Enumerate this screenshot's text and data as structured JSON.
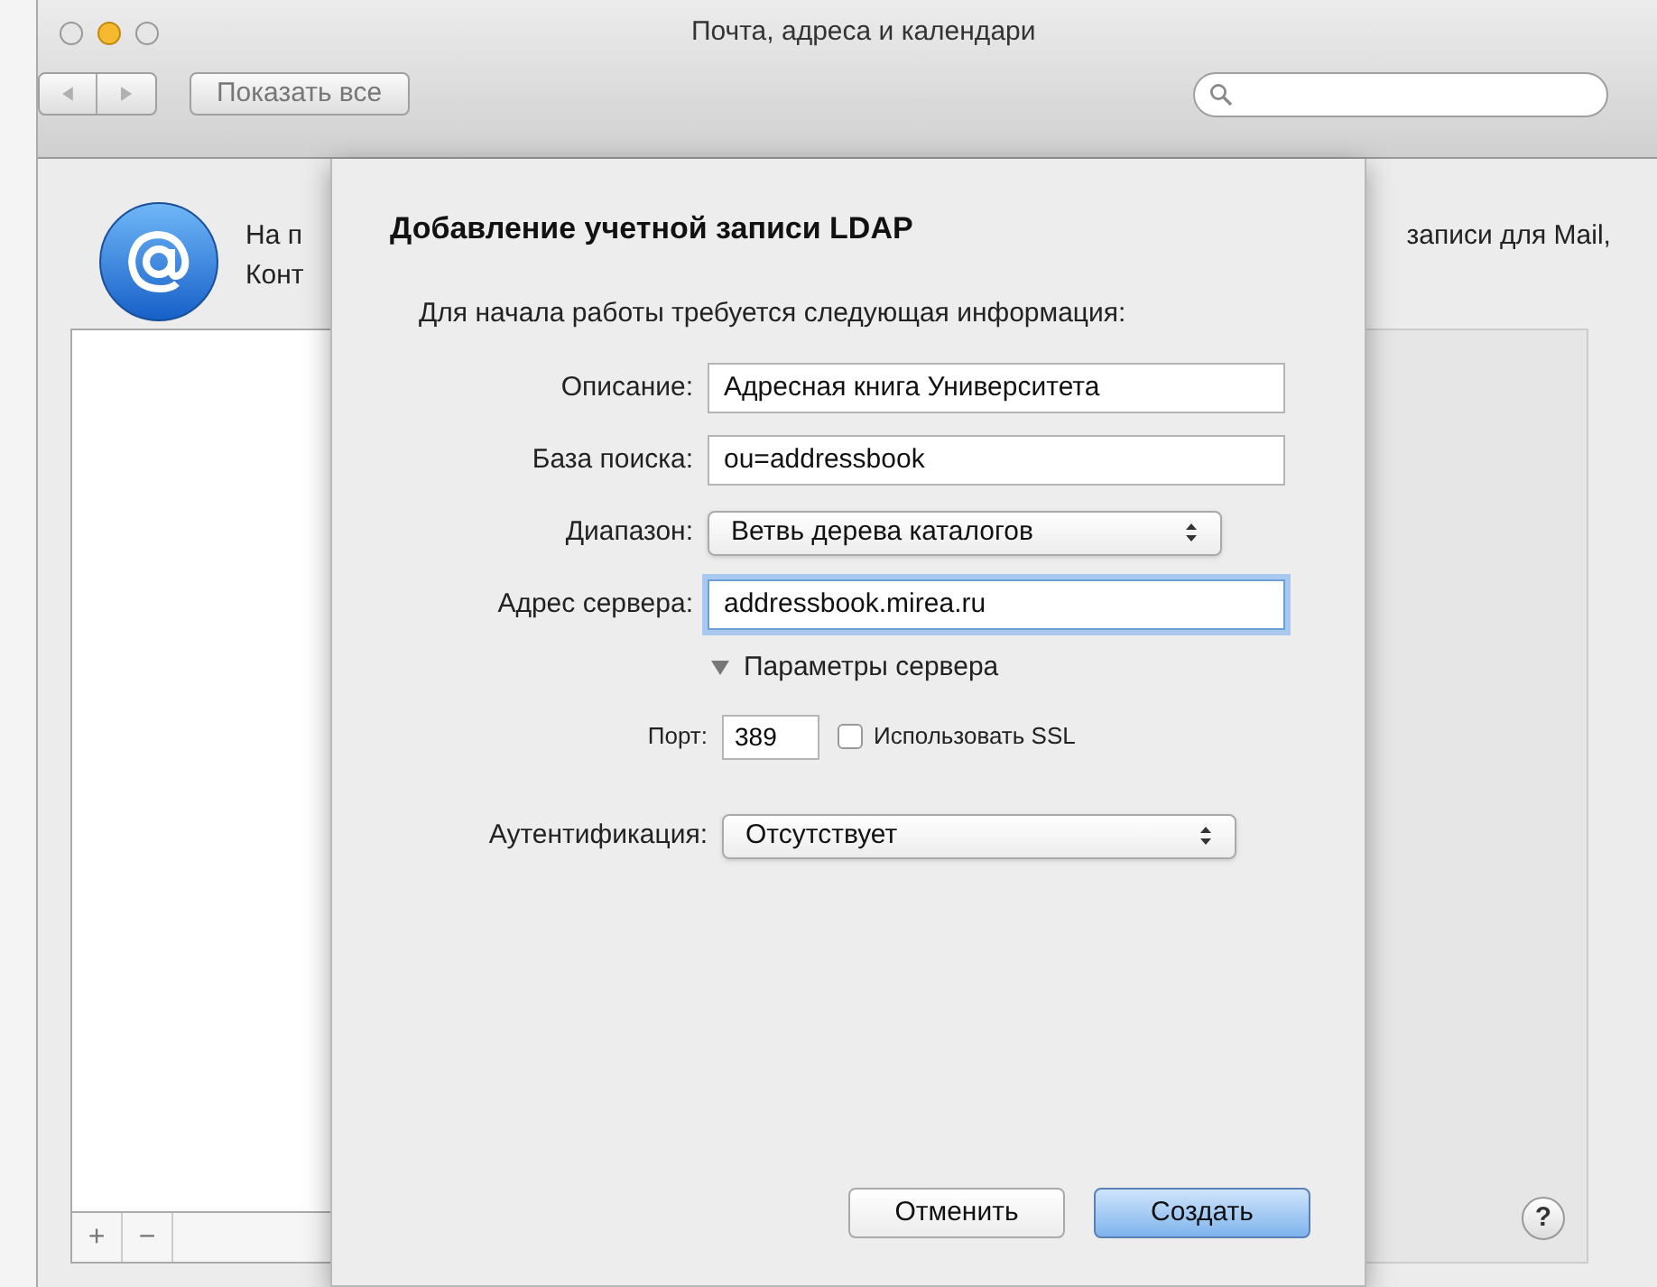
{
  "window": {
    "title": "Почта, адреса и календари"
  },
  "toolbar": {
    "show_all_button": "Показать все"
  },
  "intro": {
    "text_left_line_1": "На п",
    "text_left_line_2": "Конт",
    "text_right": "записи для Mail,"
  },
  "accounts_list": {
    "add_button": "+",
    "remove_button": "−"
  },
  "sheet": {
    "title": "Добавление учетной записи LDAP",
    "instruction": "Для начала работы требуется следующая информация:",
    "fields": [
      {
        "kind": "text",
        "label": "Описание:",
        "value": "Адресная книга Университета",
        "focused": false
      },
      {
        "kind": "text",
        "label": "База поиска:",
        "value": "ou=addressbook",
        "focused": false
      },
      {
        "kind": "select",
        "label": "Диапазон:",
        "value": "Ветвь дерева каталогов"
      },
      {
        "kind": "text",
        "label": "Адрес сервера:",
        "value": "addressbook.mirea.ru",
        "focused": true
      }
    ],
    "server_params": {
      "label": "Параметры сервера",
      "expanded": true,
      "port_label": "Порт:",
      "port": "389",
      "ssl_label": "Использовать SSL",
      "ssl_checked": false
    },
    "auth": {
      "label": "Аутентификация:",
      "value": "Отсутствует"
    },
    "buttons": [
      {
        "label": "Отменить",
        "default": false
      },
      {
        "label": "Создать",
        "default": true
      }
    ]
  },
  "help_button": "?"
}
